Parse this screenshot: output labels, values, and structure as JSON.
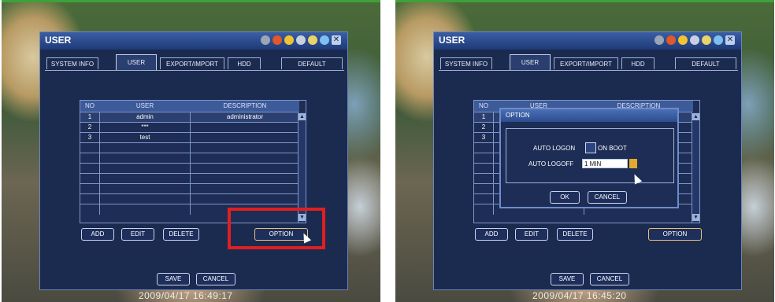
{
  "left": {
    "window": {
      "title": "USER",
      "tabs": [
        "SYSTEM INFO",
        "USER",
        "EXPORT/IMPORT",
        "HDD",
        "DEFAULT"
      ],
      "table": {
        "headers": [
          "NO",
          "USER",
          "DESCRIPTION"
        ],
        "rows": [
          [
            "1",
            "admin",
            "administrator"
          ],
          [
            "2",
            "***",
            ""
          ],
          [
            "3",
            "test",
            ""
          ]
        ]
      },
      "buttons": {
        "add": "ADD",
        "edit": "EDIT",
        "delete": "DELETE",
        "option": "OPTION"
      },
      "footer": {
        "save": "SAVE",
        "cancel": "CANCEL"
      }
    },
    "timestamp": "2009/04/17 16:49:17"
  },
  "right": {
    "window": {
      "title": "USER",
      "tabs": [
        "SYSTEM INFO",
        "USER",
        "EXPORT/IMPORT",
        "HDD",
        "DEFAULT"
      ],
      "table": {
        "headers": [
          "NO",
          "USER",
          "DESCRIPTION"
        ],
        "rows": [
          [
            "1"
          ],
          [
            "2"
          ],
          [
            "3"
          ]
        ]
      },
      "buttons": {
        "add": "ADD",
        "edit": "EDIT",
        "delete": "DELETE",
        "option": "OPTION"
      },
      "footer": {
        "save": "SAVE",
        "cancel": "CANCEL"
      }
    },
    "dialog": {
      "title": "OPTION",
      "auto_logon": "AUTO LOGON",
      "on_boot": "ON BOOT",
      "auto_logoff": "AUTO LOGOFF",
      "logoff_value": "1 MIN",
      "ok": "OK",
      "cancel": "CANCEL"
    },
    "timestamp": "2009/04/17 16:45:20"
  },
  "icons": [
    "camera-icon",
    "record-icon",
    "smile-icon",
    "wrench-icon",
    "star-icon",
    "info-icon",
    "close-icon"
  ],
  "colors": {
    "window_bg": "#1b2a4f",
    "titlebar": "#2c4d90",
    "highlight": "#e01f1f",
    "option_border": "#e7c07a"
  }
}
